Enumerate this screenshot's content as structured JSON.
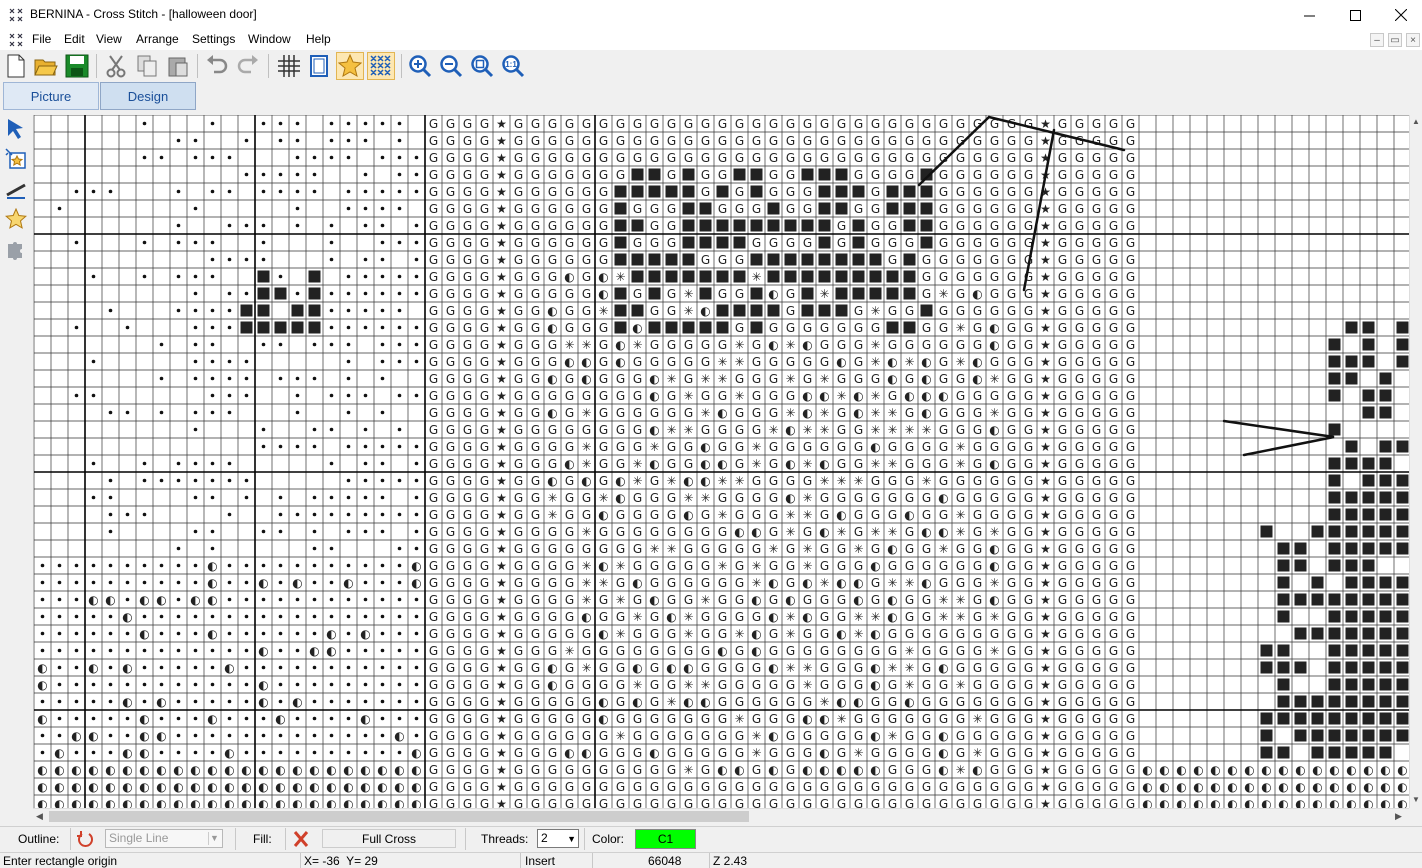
{
  "window": {
    "title": "BERNINA - Cross Stitch - [halloween door]",
    "icon": "bernina-cross-stitch-icon"
  },
  "menu": {
    "items": [
      "File",
      "Edit",
      "View",
      "Arrange",
      "Settings",
      "Window",
      "Help"
    ]
  },
  "toolbar": {
    "buttons": [
      "new-icon",
      "open-icon",
      "save-icon",
      "cut-icon",
      "copy-icon",
      "paste-icon",
      "undo-icon",
      "redo-icon",
      "grid-icon",
      "page-icon",
      "stitch-star-icon",
      "cross-fill-icon",
      "zoom-in-icon",
      "zoom-out-icon",
      "zoom-fit-icon",
      "zoom-1to1-icon"
    ],
    "zoom_1to1_label": "1:1"
  },
  "tabs": {
    "picture": "Picture",
    "design": "Design",
    "active": "Design"
  },
  "left_tools": [
    "select-arrow-icon",
    "insert-image-icon",
    "backstitch-line-icon",
    "star-stitch-icon",
    "puzzle-icon"
  ],
  "properties": {
    "outline_label": "Outline:",
    "outline_style": "Single Line",
    "fill_label": "Fill:",
    "fill_type": "Full Cross",
    "threads_label": "Threads:",
    "threads_value": "2",
    "color_label": "Color:",
    "color_value": "C1",
    "color_hex": "#00ff00"
  },
  "status": {
    "prompt": "Enter rectangle origin",
    "coords": "X= -36  Y= 29",
    "mode": "Insert",
    "count": "66048",
    "zoom": "Z 2.43"
  },
  "colors": {
    "accent": "#1a4f99",
    "save_green": "#1a8a2a",
    "folder_yellow": "#e8b030",
    "zoom_blue": "#1f5fb8",
    "star_orange": "#e8a020"
  }
}
